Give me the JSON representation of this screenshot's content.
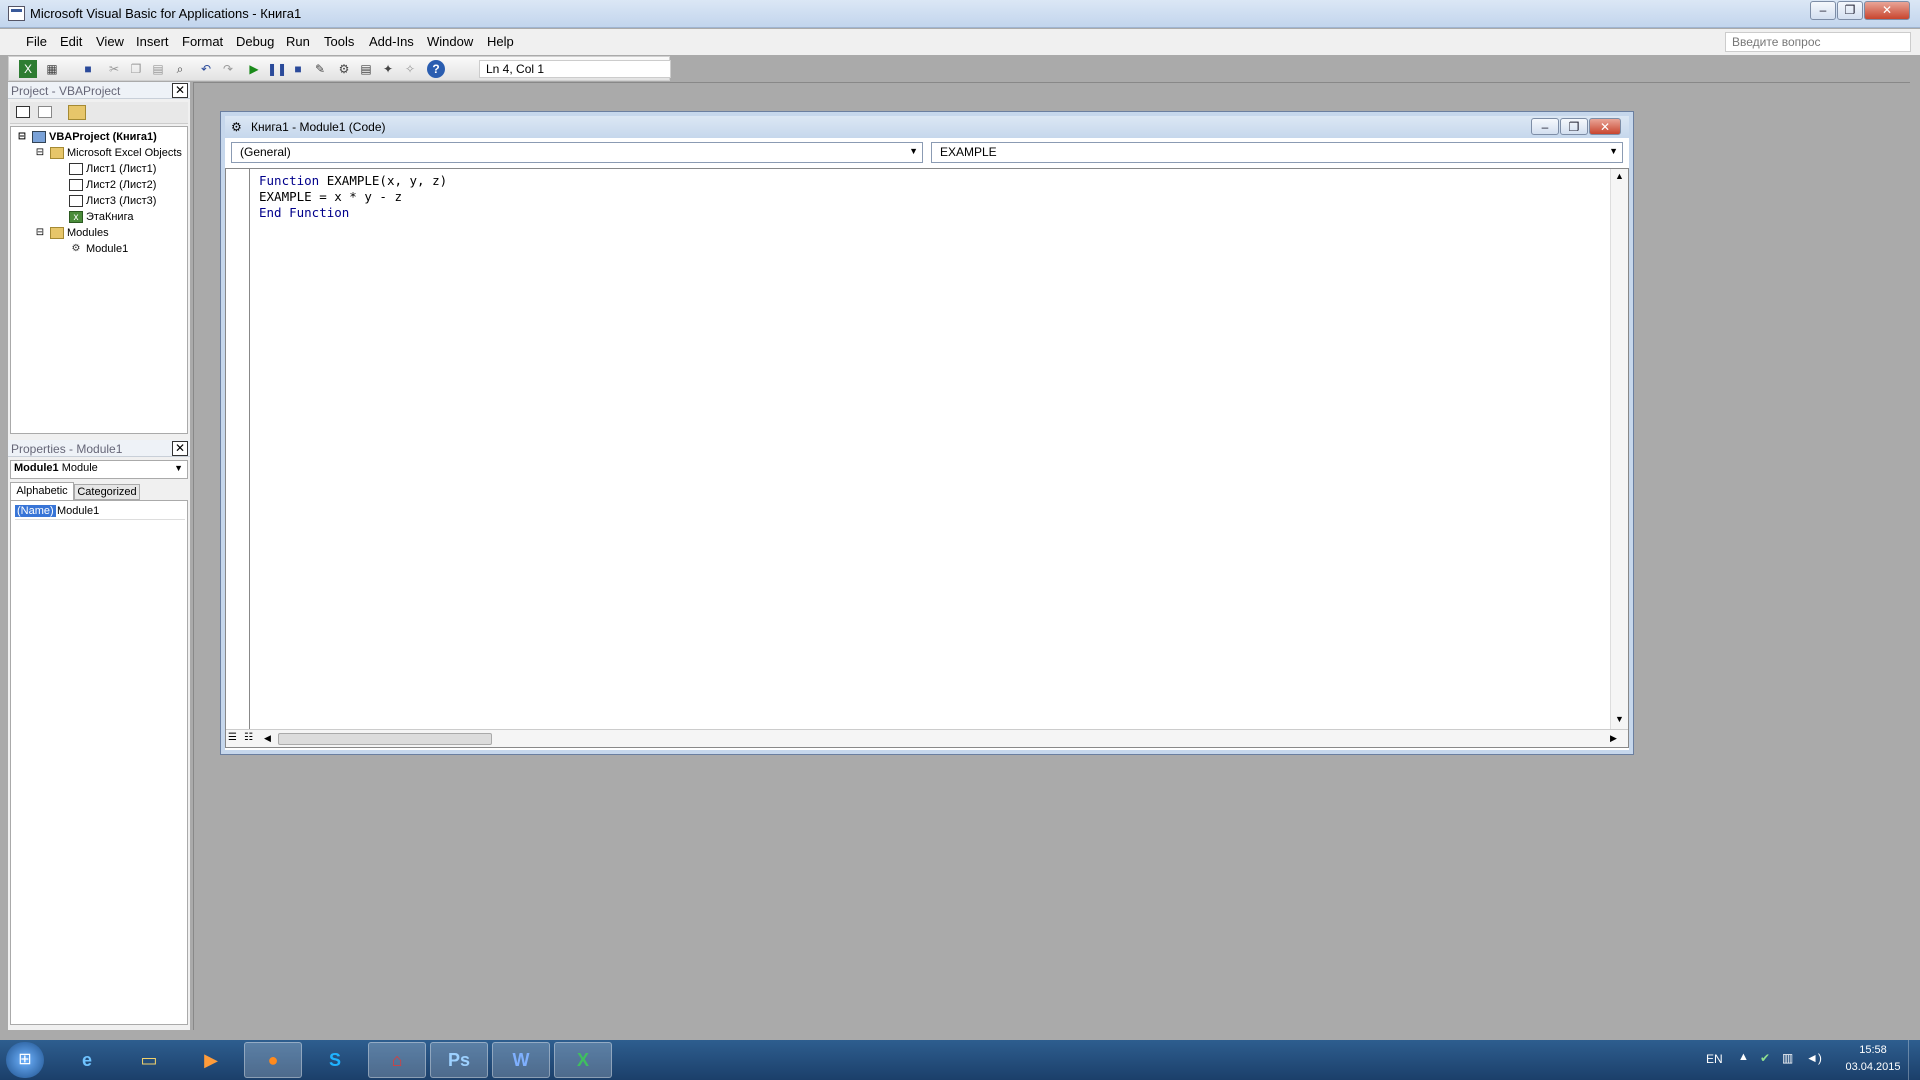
{
  "window": {
    "title": "Microsoft Visual Basic for Applications - Книга1",
    "ask_placeholder": "Введите вопрос"
  },
  "menu": [
    "File",
    "Edit",
    "View",
    "Insert",
    "Format",
    "Debug",
    "Run",
    "Tools",
    "Add-Ins",
    "Window",
    "Help"
  ],
  "toolbar": {
    "position": "Ln 4, Col 1"
  },
  "project": {
    "header": "Project - VBAProject",
    "root": "VBAProject (Книга1)",
    "excel_objects": "Microsoft Excel Objects",
    "sheets": [
      "Лист1 (Лист1)",
      "Лист2 (Лист2)",
      "Лист3 (Лист3)"
    ],
    "workbook": "ЭтаКнига",
    "modules_folder": "Modules",
    "module": "Module1"
  },
  "properties": {
    "header": "Properties - Module1",
    "object_name": "Module1",
    "object_type": "Module",
    "tab_alpha": "Alphabetic",
    "tab_cat": "Categorized",
    "prop_name": "(Name)",
    "prop_value": "Module1"
  },
  "code_window": {
    "title": "Книга1 - Module1 (Code)",
    "object_combo": "(General)",
    "proc_combo": "EXAMPLE",
    "lines": {
      "l1_kw": "Function",
      "l1_rest": " EXAMPLE(x, y, z)",
      "l2": "EXAMPLE = x * y - z",
      "l3": "End Function"
    }
  },
  "tray": {
    "lang": "EN",
    "time": "15:58",
    "date": "03.04.2015"
  },
  "taskbar_apps": [
    "Internet Explorer",
    "File Explorer",
    "Media Player",
    "Firefox",
    "Skype",
    "Adobe Reader",
    "Photoshop",
    "Word",
    "Excel"
  ]
}
